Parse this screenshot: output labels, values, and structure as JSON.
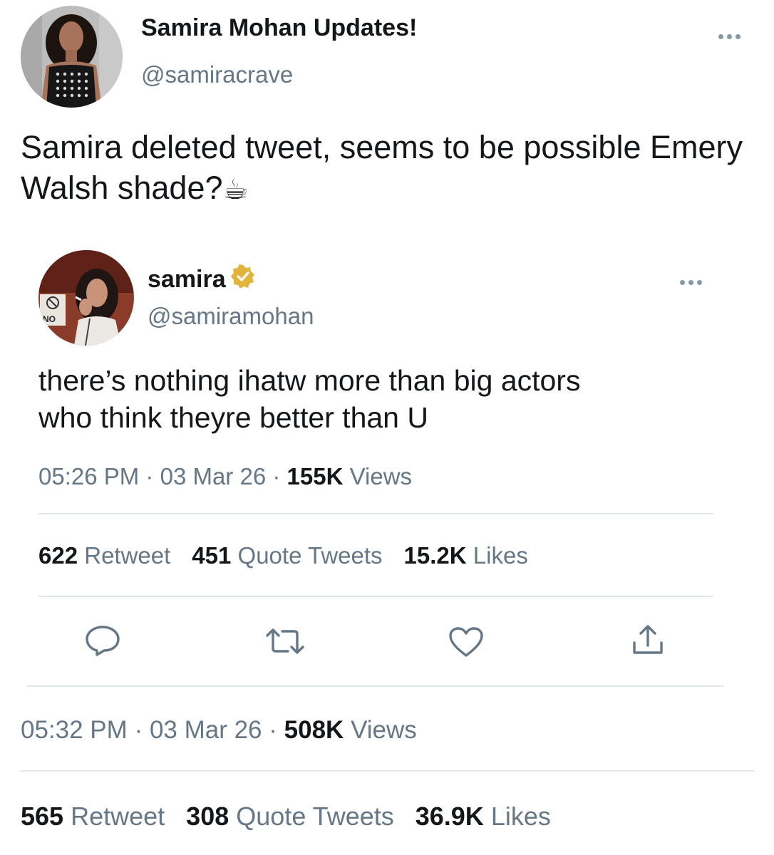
{
  "outer_tweet": {
    "display_name": "Samira Mohan Updates!",
    "handle": "@samiracrave",
    "text": "Samira deleted tweet, seems to be possible Emery Walsh shade?",
    "emoji": "☕",
    "time": "05:32 PM",
    "date": "03 Mar 26",
    "views_count": "508K",
    "views_label": "Views",
    "retweets_count": "565",
    "retweets_label": "Retweet",
    "quotes_count": "308",
    "quotes_label": "Quote Tweets",
    "likes_count": "36.9K",
    "likes_label": "Likes"
  },
  "quoted_tweet": {
    "display_name": "samira",
    "verified": true,
    "handle": "@samiramohan",
    "text_line1": "there’s nothing ihatw more than big actors",
    "text_line2": "who think theyre better than U",
    "time": "05:26 PM",
    "date": "03 Mar 26",
    "views_count": "155K",
    "views_label": "Views",
    "retweets_count": "622",
    "retweets_label": "Retweet",
    "quotes_count": "451",
    "quotes_label": "Quote Tweets",
    "likes_count": "15.2K",
    "likes_label": "Likes",
    "avatar_sign_text": "NO",
    "actions": [
      "reply-icon",
      "retweet-icon",
      "like-icon",
      "share-icon"
    ]
  },
  "colors": {
    "text": "#14171a",
    "secondary": "#657786",
    "divider": "#e1e8ed",
    "verified_gold": "#e2b43b"
  }
}
